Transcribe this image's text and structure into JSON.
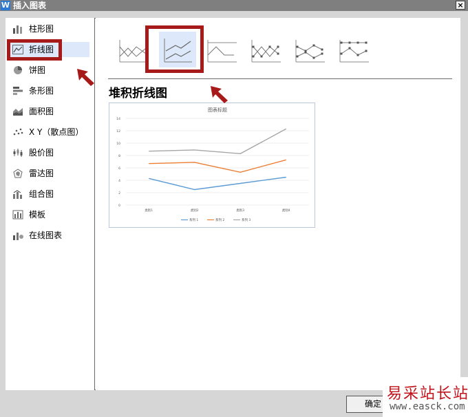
{
  "window": {
    "title": "插入图表",
    "app_icon": "W",
    "close_label": "×"
  },
  "categories": [
    {
      "label": "柱形图",
      "icon": "column-chart-icon"
    },
    {
      "label": "折线图",
      "icon": "line-chart-icon",
      "selected": true
    },
    {
      "label": "饼图",
      "icon": "pie-chart-icon"
    },
    {
      "label": "条形图",
      "icon": "bar-chart-icon"
    },
    {
      "label": "面积图",
      "icon": "area-chart-icon"
    },
    {
      "label": "X Y（散点图）",
      "icon": "scatter-chart-icon"
    },
    {
      "label": "股价图",
      "icon": "stock-chart-icon"
    },
    {
      "label": "雷达图",
      "icon": "radar-chart-icon"
    },
    {
      "label": "组合图",
      "icon": "combo-chart-icon"
    },
    {
      "label": "模板",
      "icon": "template-icon"
    },
    {
      "label": "在线图表",
      "icon": "online-chart-icon"
    }
  ],
  "subtypes": {
    "selected_index": 1,
    "selected_title": "堆积折线图"
  },
  "preview": {
    "title": "图表标题",
    "categories": [
      "类别1",
      "类别2",
      "类别3",
      "类别4"
    ],
    "y_ticks": [
      "0",
      "2",
      "4",
      "6",
      "8",
      "10",
      "12",
      "14"
    ],
    "series": [
      {
        "name": "系列 1",
        "color": "#5b9bd5",
        "values": [
          4.3,
          2.5,
          3.5,
          4.5
        ]
      },
      {
        "name": "系列 2",
        "color": "#ed7d31",
        "values": [
          6.7,
          6.9,
          5.3,
          7.3
        ]
      },
      {
        "name": "系列 3",
        "color": "#a5a5a5",
        "values": [
          8.7,
          8.9,
          8.3,
          12.3
        ]
      }
    ]
  },
  "colors": {
    "highlight": "#a71a1a",
    "selection": "#dde8fa"
  },
  "buttons": {
    "ok_label": "确定"
  },
  "watermark": {
    "text": "易采站长站",
    "url": "www.easck.com"
  }
}
